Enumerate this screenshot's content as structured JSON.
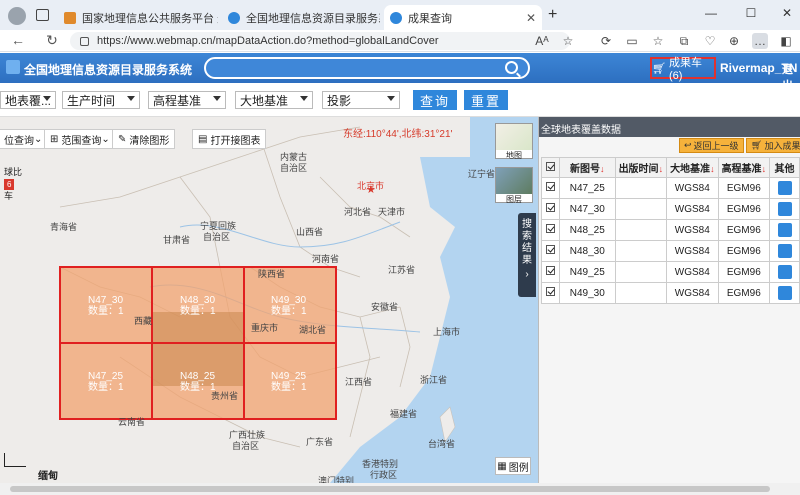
{
  "browser": {
    "tabs": [
      {
        "label": "国家地理信息公共服务平台 天地图",
        "active": false
      },
      {
        "label": "全国地理信息资源目录服务系统",
        "active": false
      },
      {
        "label": "成果查询",
        "active": true
      }
    ],
    "url": "https://www.webmap.cn/mapDataAction.do?method=globalLandCover",
    "reader_label": "Aᴬ"
  },
  "site": {
    "title": "全国地理信息资源目录服务系统",
    "cart_label": "成果车(6)",
    "user": "Rivermap_TN",
    "logout": "退出"
  },
  "filters": {
    "selects": [
      "地表覆...",
      "生产时间",
      "高程基准",
      "大地基准",
      "投影"
    ],
    "query_button": "查询",
    "reset_button": "重置"
  },
  "map": {
    "tools": [
      "位查询",
      "范围查询",
      "清除图形",
      "打开接图表"
    ],
    "coordinate": "东经:110°44',北纬:31°21'",
    "labels": [
      {
        "text": "内蒙古",
        "city": false
      },
      {
        "text": "自治区",
        "city": false
      },
      {
        "text": "辽宁省",
        "city": false
      },
      {
        "text": "北京市",
        "city": true
      },
      {
        "text": "河北省",
        "city": false
      },
      {
        "text": "天津市",
        "city": false
      },
      {
        "text": "宁夏回族",
        "city": false
      },
      {
        "text": "自治区",
        "city": false
      },
      {
        "text": "山西省",
        "city": false
      },
      {
        "text": "青海省",
        "city": false
      },
      {
        "text": "甘肃省",
        "city": false
      },
      {
        "text": "河南省",
        "city": false
      },
      {
        "text": "陕西省",
        "city": false
      },
      {
        "text": "江苏省",
        "city": false
      },
      {
        "text": "安徽省",
        "city": false
      },
      {
        "text": "湖北省",
        "city": false
      },
      {
        "text": "上海市",
        "city": false
      },
      {
        "text": "西藏",
        "city": false
      },
      {
        "text": "重庆市",
        "city": false
      },
      {
        "text": "贵州省",
        "city": false
      },
      {
        "text": "江西省",
        "city": false
      },
      {
        "text": "浙江省",
        "city": false
      },
      {
        "text": "福建省",
        "city": false
      },
      {
        "text": "云南省",
        "city": false
      },
      {
        "text": "广西壮族",
        "city": false
      },
      {
        "text": "自治区",
        "city": false
      },
      {
        "text": "广东省",
        "city": false
      },
      {
        "text": "台湾省",
        "city": false
      },
      {
        "text": "香港特别",
        "city": false
      },
      {
        "text": "行政区",
        "city": false
      },
      {
        "text": "澳门特别",
        "city": false
      }
    ],
    "tiles": [
      {
        "name": "N47_30",
        "count": "数量：1"
      },
      {
        "name": "N48_30",
        "count": "数量：1"
      },
      {
        "name": "N49_30",
        "count": "数量：1"
      },
      {
        "name": "N47_25",
        "count": "数量：1"
      },
      {
        "name": "N48_25",
        "count": "数量：1"
      },
      {
        "name": "N49_25",
        "count": "数量：1"
      }
    ],
    "thumbs": [
      "地图",
      "图层"
    ],
    "side_tab": "搜索结果",
    "legend_button": "图例",
    "left_badge_top": "球比",
    "left_badge_count": "6",
    "left_badge_bottom": "车",
    "scale_label": "缅甸"
  },
  "panel": {
    "title": "全球地表覆盖数据",
    "back_button": "返回上一级",
    "add_button": "加入成果",
    "columns": [
      "新图号",
      "出版时间",
      "大地基准",
      "高程基准",
      "其他"
    ],
    "rows": [
      {
        "sheet": "N47_25",
        "date": "",
        "datum": "WGS84",
        "height": "EGM96"
      },
      {
        "sheet": "N47_30",
        "date": "",
        "datum": "WGS84",
        "height": "EGM96"
      },
      {
        "sheet": "N48_25",
        "date": "",
        "datum": "WGS84",
        "height": "EGM96"
      },
      {
        "sheet": "N48_30",
        "date": "",
        "datum": "WGS84",
        "height": "EGM96"
      },
      {
        "sheet": "N49_25",
        "date": "",
        "datum": "WGS84",
        "height": "EGM96"
      },
      {
        "sheet": "N49_30",
        "date": "",
        "datum": "WGS84",
        "height": "EGM96"
      }
    ]
  },
  "colors": {
    "accent": "#2f87db",
    "header": "#3478c9",
    "tile_fill": "#f2a36f",
    "tile_stroke": "#e02020",
    "cart_border": "#e0322f"
  }
}
